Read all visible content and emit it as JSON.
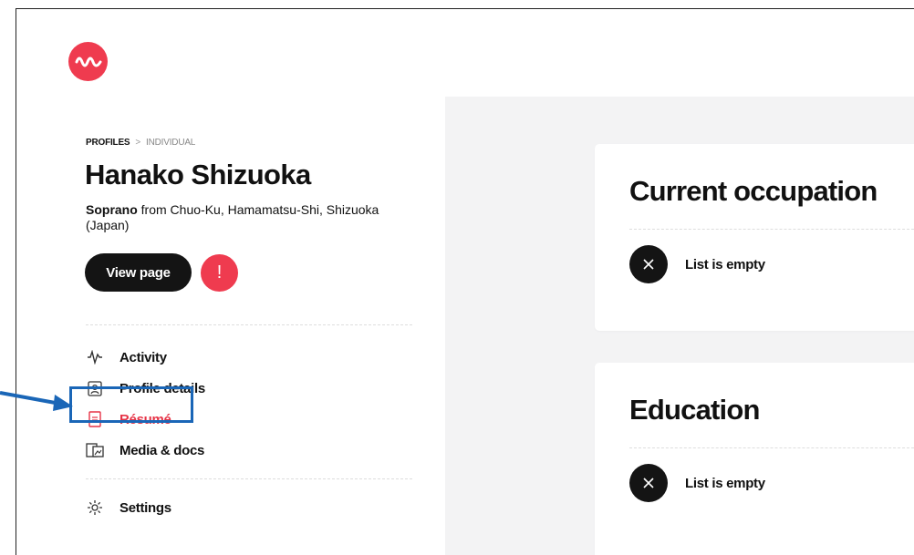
{
  "brand": {
    "logo_icon": "wave-logo-icon",
    "color": "#ef3b4f"
  },
  "breadcrumb": {
    "root": "PROFILES",
    "separator": ">",
    "current": "INDIVIDUAL"
  },
  "profile": {
    "name": "Hanako Shizuoka",
    "role": "Soprano",
    "location_text": " from Chuo-Ku, Hamamatsu-Shi, Shizuoka (Japan)"
  },
  "actions": {
    "view_page": "View page",
    "alert_symbol": "!"
  },
  "nav": [
    {
      "label": "Activity",
      "icon": "activity-icon"
    },
    {
      "label": "Profile details",
      "icon": "profile-card-icon"
    },
    {
      "label": "Résumé",
      "icon": "document-icon",
      "active": true
    },
    {
      "label": "Media & docs",
      "icon": "media-icon"
    }
  ],
  "settings": {
    "label": "Settings",
    "icon": "gear-icon"
  },
  "cards": [
    {
      "title": "Current occupation",
      "empty_text": "List is empty"
    },
    {
      "title": "Education",
      "empty_text": "List is empty"
    }
  ],
  "colors": {
    "accent": "#ef3b4f",
    "annotation": "#1a66b7",
    "dark": "#141414"
  }
}
